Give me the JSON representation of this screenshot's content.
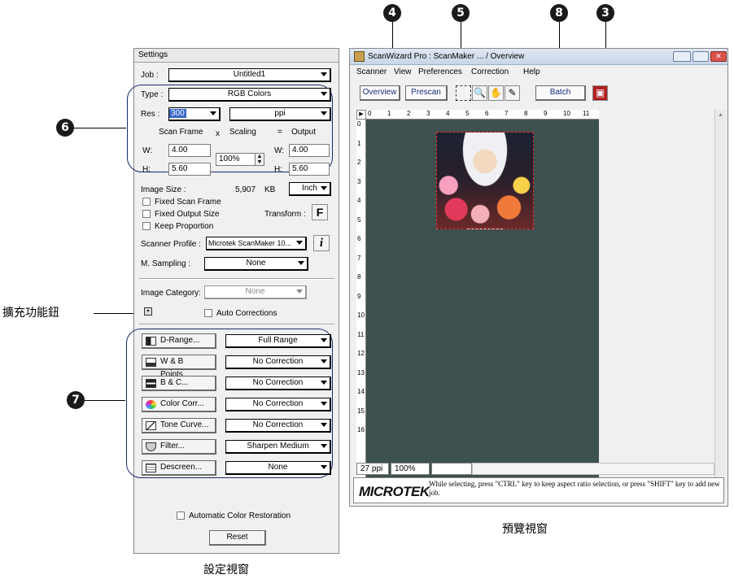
{
  "callouts": {
    "c4": "4",
    "c5": "5",
    "c8": "8",
    "c3": "3",
    "c6": "6",
    "c7": "7"
  },
  "expand_button_label": "擴充功能鈕",
  "captions": {
    "settings": "設定視窗",
    "preview": "預覽視窗"
  },
  "settings": {
    "title": "Settings",
    "job_label": "Job :",
    "job_value": "Untitled1",
    "type_label": "Type :",
    "type_value": "RGB Colors",
    "res_label": "Res :",
    "res_value": "300",
    "res_unit": "ppi",
    "scan_frame_label": "Scan Frame",
    "x_label": "x",
    "scaling_label": "Scaling",
    "eq_label": "=",
    "output_label": "Output",
    "w_label": "W:",
    "h_label": "H:",
    "scan_w": "4.00",
    "scan_h": "5.60",
    "scaling_value": "100%",
    "out_w": "4.00",
    "out_h": "5.60",
    "image_size_label": "Image Size :",
    "image_size_value": "5,907",
    "image_size_unit": "KB",
    "inch_value": "Inch",
    "fixed_scan_frame": "Fixed Scan Frame",
    "fixed_output_size": "Fixed Output Size",
    "transform_label": "Transform :",
    "transform_icon": "F",
    "keep_proportion": "Keep Proportion",
    "scanner_profile_label": "Scanner Profile :",
    "scanner_profile_value": "Microtek ScanMaker 10...",
    "info_icon": "i",
    "m_sampling_label": "M. Sampling :",
    "m_sampling_value": "None",
    "image_category_label": "Image Category:",
    "image_category_value": "None",
    "auto_corrections": "Auto Corrections",
    "corrections": [
      {
        "button": "D-Range...",
        "value": "Full Range"
      },
      {
        "button": "W & B Points...",
        "value": "No Correction"
      },
      {
        "button": "B & C...",
        "value": "No Correction"
      },
      {
        "button": "Color Corr...",
        "value": "No Correction"
      },
      {
        "button": "Tone Curve...",
        "value": "No Correction"
      },
      {
        "button": "Filter...",
        "value": "Sharpen Medium"
      },
      {
        "button": "Descreen...",
        "value": "None"
      }
    ],
    "auto_color_restoration": "Automatic Color Restoration",
    "reset": "Reset"
  },
  "preview": {
    "title": "ScanWizard Pro : ScanMaker ... / Overview",
    "menu": [
      "Scanner",
      "View",
      "Preferences",
      "Correction",
      "Help"
    ],
    "overview_btn": "Overview",
    "prescan_btn": "Prescan",
    "batch_btn": "Batch",
    "ruler_h": [
      "0",
      "1",
      "2",
      "3",
      "4",
      "5",
      "6",
      "7",
      "8",
      "9",
      "10",
      "11"
    ],
    "ruler_v": [
      "0",
      "1",
      "2",
      "3",
      "4",
      "5",
      "6",
      "7",
      "8",
      "9",
      "10",
      "11",
      "12",
      "13",
      "14",
      "15",
      "16"
    ],
    "status_res": "27 ppi",
    "status_zoom": "100%",
    "logo": "MICROTEK",
    "hint": "While selecting, press \"CTRL\" key to keep aspect ratio selection, or press \"SHIFT\" key to add new job."
  },
  "colors": {
    "canvas": "#3d514f",
    "selection": "#ee3333",
    "oval": "#1b2a6b"
  }
}
